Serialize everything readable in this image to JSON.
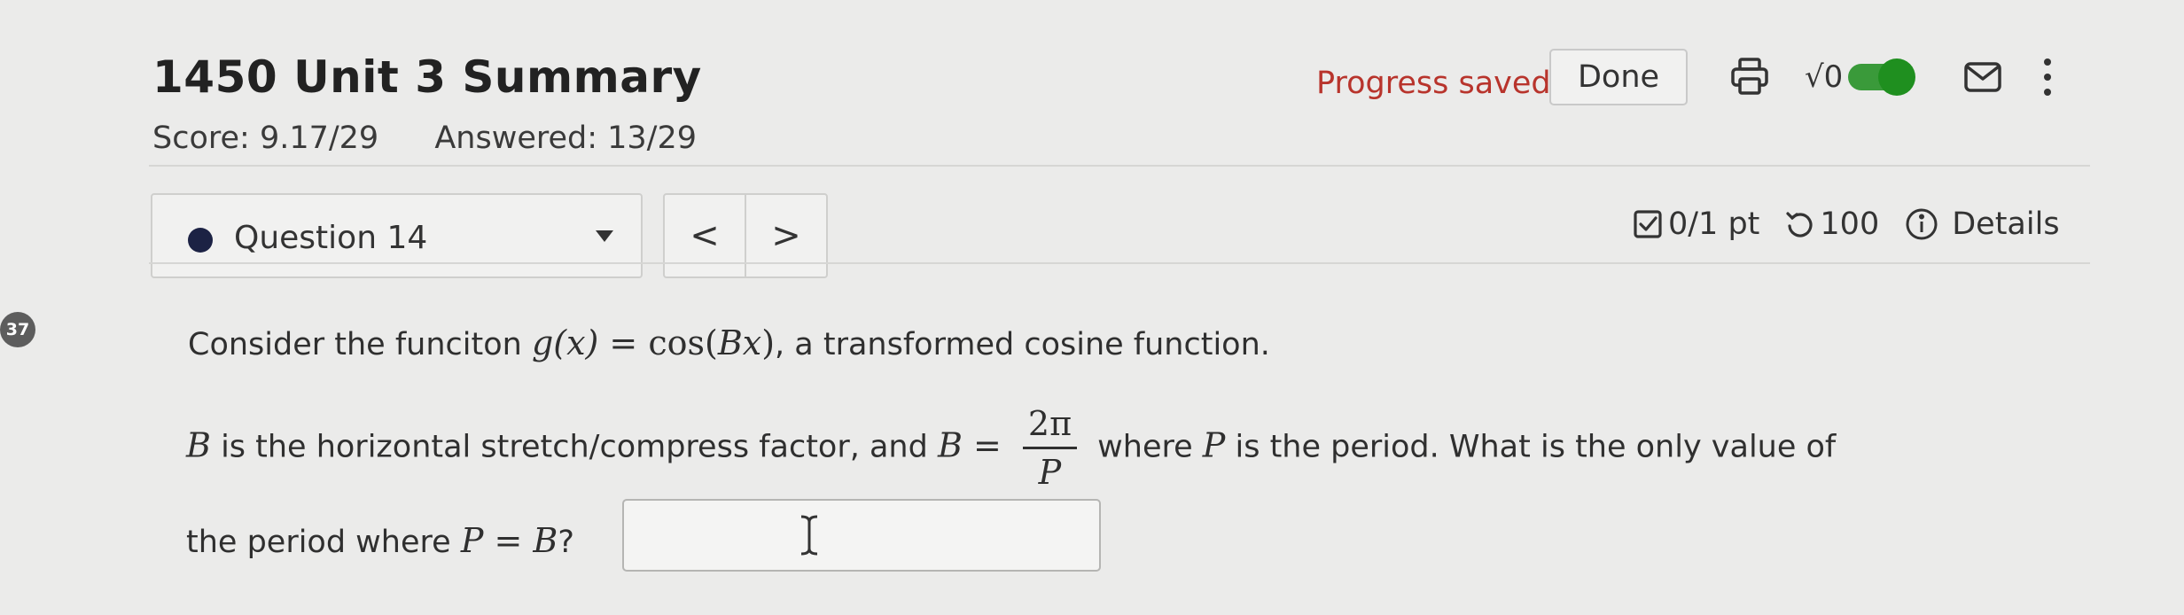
{
  "header": {
    "title": "1450 Unit 3 Summary",
    "score": "Score: 9.17/29",
    "answered": "Answered: 13/29",
    "progress_status": "Progress saved",
    "done_label": "Done",
    "sqrt_label": "√0",
    "toggle_on": true
  },
  "question_nav": {
    "selected": "Question 14",
    "prev_glyph": "<",
    "next_glyph": ">"
  },
  "score_bar": {
    "points": "0/1 pt",
    "attempts": "100",
    "details_label": "Details"
  },
  "side_badge": "37",
  "question": {
    "line1_a": "Consider the funciton ",
    "g_x": "g(x)",
    "eq": " = ",
    "cos_prefix": "cos(",
    "B": "B",
    "x": "x",
    "cos_suffix": ")",
    "line1_b": ", a transformed cosine function.",
    "line2_a": " is the horizontal stretch/compress factor, and ",
    "frac_num": "2π",
    "frac_den": "P",
    "line2_b": " where ",
    "P": "P",
    "line2_c": " is the period. What is the only value of",
    "line3_a": "the period where ",
    "line3_b": "?",
    "answer_value": ""
  },
  "colors": {
    "accent_red": "#b8342c",
    "toggle_green": "#2f9e2f",
    "dot_navy": "#1c2244"
  },
  "icons": [
    "printer-icon",
    "sqrt-icon",
    "toggle-switch",
    "mail-icon",
    "kebab-menu-icon",
    "checkbox-icon",
    "retry-icon",
    "info-icon",
    "text-cursor-icon"
  ]
}
